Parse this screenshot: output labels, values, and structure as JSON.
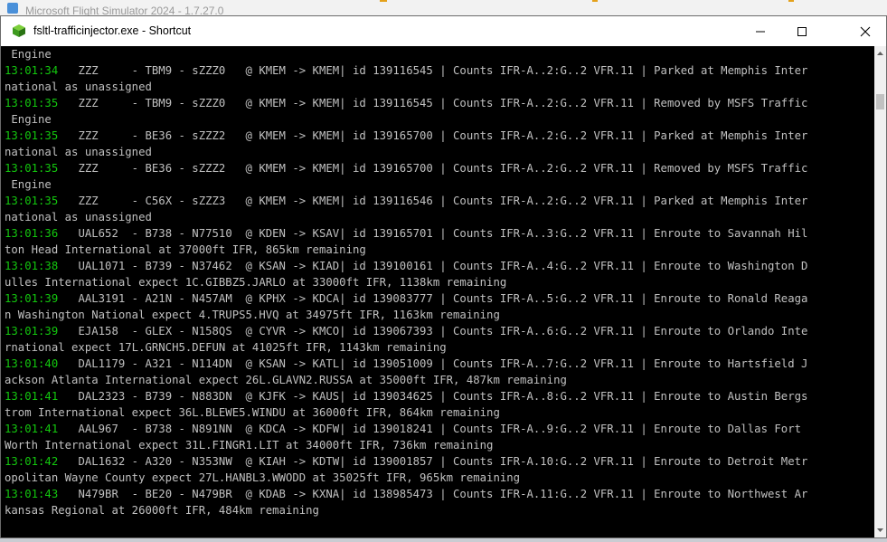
{
  "background_window": {
    "title": "Microsoft Flight Simulator 2024 - 1.7.27.0"
  },
  "window": {
    "title": "fsltl-trafficinjector.exe - Shortcut",
    "icon": "green-cube-icon",
    "controls": [
      "minimize-icon",
      "maximize-icon",
      "close-icon"
    ]
  },
  "colors": {
    "timestamp": "#13c70e",
    "text": "#c0c0c0",
    "background": "#000000"
  },
  "console_lines": [
    {
      "ts": "",
      "text": " Engine"
    },
    {
      "ts": "13:01:34",
      "text": "   ZZZ     - TBM9 - sZZZ0   @ KMEM -> KMEM| id 139116545 | Counts IFR-A..2:G..2 VFR.11 | Parked at Memphis Inter"
    },
    {
      "ts": "",
      "text": "national as unassigned"
    },
    {
      "ts": "13:01:35",
      "text": "   ZZZ     - TBM9 - sZZZ0   @ KMEM -> KMEM| id 139116545 | Counts IFR-A..2:G..2 VFR.11 | Removed by MSFS Traffic"
    },
    {
      "ts": "",
      "text": " Engine"
    },
    {
      "ts": "13:01:35",
      "text": "   ZZZ     - BE36 - sZZZ2   @ KMEM -> KMEM| id 139165700 | Counts IFR-A..2:G..2 VFR.11 | Parked at Memphis Inter"
    },
    {
      "ts": "",
      "text": "national as unassigned"
    },
    {
      "ts": "13:01:35",
      "text": "   ZZZ     - BE36 - sZZZ2   @ KMEM -> KMEM| id 139165700 | Counts IFR-A..2:G..2 VFR.11 | Removed by MSFS Traffic"
    },
    {
      "ts": "",
      "text": " Engine"
    },
    {
      "ts": "13:01:35",
      "text": "   ZZZ     - C56X - sZZZ3   @ KMEM -> KMEM| id 139116546 | Counts IFR-A..2:G..2 VFR.11 | Parked at Memphis Inter"
    },
    {
      "ts": "",
      "text": "national as unassigned"
    },
    {
      "ts": "13:01:36",
      "text": "   UAL652  - B738 - N77510  @ KDEN -> KSAV| id 139165701 | Counts IFR-A..3:G..2 VFR.11 | Enroute to Savannah Hil"
    },
    {
      "ts": "",
      "text": "ton Head International at 37000ft IFR, 865km remaining"
    },
    {
      "ts": "13:01:38",
      "text": "   UAL1071 - B739 - N37462  @ KSAN -> KIAD| id 139100161 | Counts IFR-A..4:G..2 VFR.11 | Enroute to Washington D"
    },
    {
      "ts": "",
      "text": "ulles International expect 1C.GIBBZ5.JARLO at 33000ft IFR, 1138km remaining"
    },
    {
      "ts": "13:01:39",
      "text": "   AAL3191 - A21N - N457AM  @ KPHX -> KDCA| id 139083777 | Counts IFR-A..5:G..2 VFR.11 | Enroute to Ronald Reaga"
    },
    {
      "ts": "",
      "text": "n Washington National expect 4.TRUPS5.HVQ at 34975ft IFR, 1163km remaining"
    },
    {
      "ts": "13:01:39",
      "text": "   EJA158  - GLEX - N158QS  @ CYVR -> KMCO| id 139067393 | Counts IFR-A..6:G..2 VFR.11 | Enroute to Orlando Inte"
    },
    {
      "ts": "",
      "text": "rnational expect 17L.GRNCH5.DEFUN at 41025ft IFR, 1143km remaining"
    },
    {
      "ts": "13:01:40",
      "text": "   DAL1179 - A321 - N114DN  @ KSAN -> KATL| id 139051009 | Counts IFR-A..7:G..2 VFR.11 | Enroute to Hartsfield J"
    },
    {
      "ts": "",
      "text": "ackson Atlanta International expect 26L.GLAVN2.RUSSA at 35000ft IFR, 487km remaining"
    },
    {
      "ts": "13:01:41",
      "text": "   DAL2323 - B739 - N883DN  @ KJFK -> KAUS| id 139034625 | Counts IFR-A..8:G..2 VFR.11 | Enroute to Austin Bergs"
    },
    {
      "ts": "",
      "text": "trom International expect 36L.BLEWE5.WINDU at 36000ft IFR, 864km remaining"
    },
    {
      "ts": "13:01:41",
      "text": "   AAL967  - B738 - N891NN  @ KDCA -> KDFW| id 139018241 | Counts IFR-A..9:G..2 VFR.11 | Enroute to Dallas Fort"
    },
    {
      "ts": "",
      "text": "Worth International expect 31L.FINGR1.LIT at 34000ft IFR, 736km remaining"
    },
    {
      "ts": "13:01:42",
      "text": "   DAL1632 - A320 - N353NW  @ KIAH -> KDTW| id 139001857 | Counts IFR-A.10:G..2 VFR.11 | Enroute to Detroit Metr"
    },
    {
      "ts": "",
      "text": "opolitan Wayne County expect 27L.HANBL3.WWODD at 35025ft IFR, 965km remaining"
    },
    {
      "ts": "13:01:43",
      "text": "   N479BR  - BE20 - N479BR  @ KDAB -> KXNA| id 138985473 | Counts IFR-A.11:G..2 VFR.11 | Enroute to Northwest Ar"
    },
    {
      "ts": "",
      "text": "kansas Regional at 26000ft IFR, 484km remaining"
    }
  ]
}
